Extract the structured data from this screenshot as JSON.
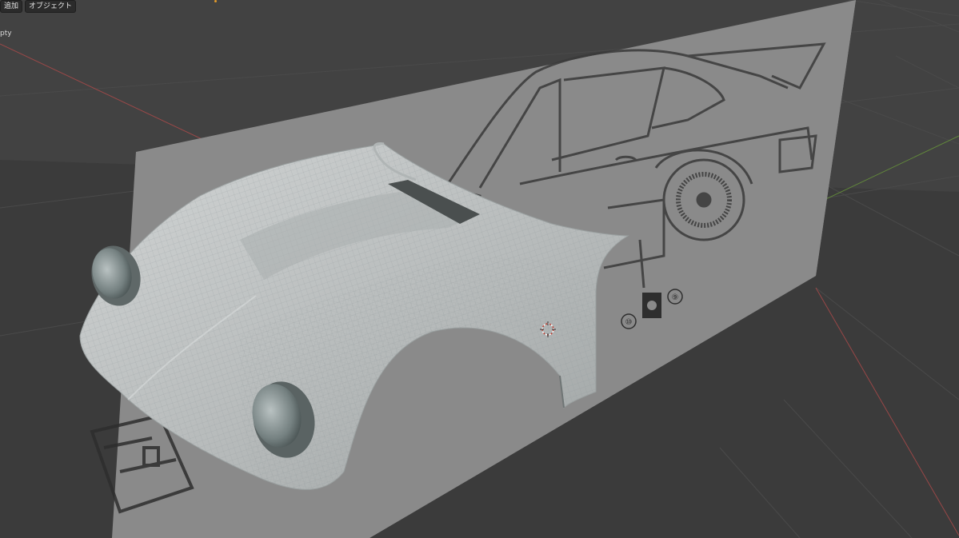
{
  "header": {
    "menu": [
      {
        "label": "追加"
      },
      {
        "label": "オブジェクト"
      }
    ]
  },
  "outliner_label": "pty",
  "scene": {
    "reference_image": {
      "circled_numbers": [
        "⑩",
        "⑨"
      ]
    },
    "colors": {
      "background": "#3a3a3a",
      "plane": "#8a8a8a",
      "body_shell": "#bcbebe",
      "axis_x": "#b04a4a",
      "axis_y": "#6a9a3a",
      "cursor": "#c0392b"
    }
  }
}
